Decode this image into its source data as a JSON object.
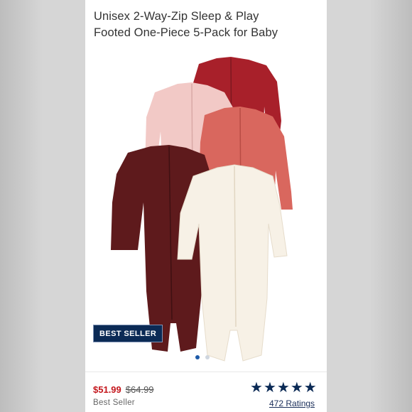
{
  "product": {
    "title_line1": "Unisex 2-Way-Zip Sleep & Play",
    "title_line2": "Footed One-Piece 5-Pack for Baby"
  },
  "gallery": {
    "badge": "BEST SELLER",
    "image_count": 2,
    "active_index": 0,
    "image_icon": "onesie-five-pack-image"
  },
  "pricing": {
    "sale_price": "$51.99",
    "original_price": "$64.99",
    "sale_color": "#c4161c"
  },
  "status": {
    "label": "Best Seller"
  },
  "rating": {
    "stars": 5,
    "star_color": "#0b2a55",
    "count_text": "472 Ratings"
  }
}
